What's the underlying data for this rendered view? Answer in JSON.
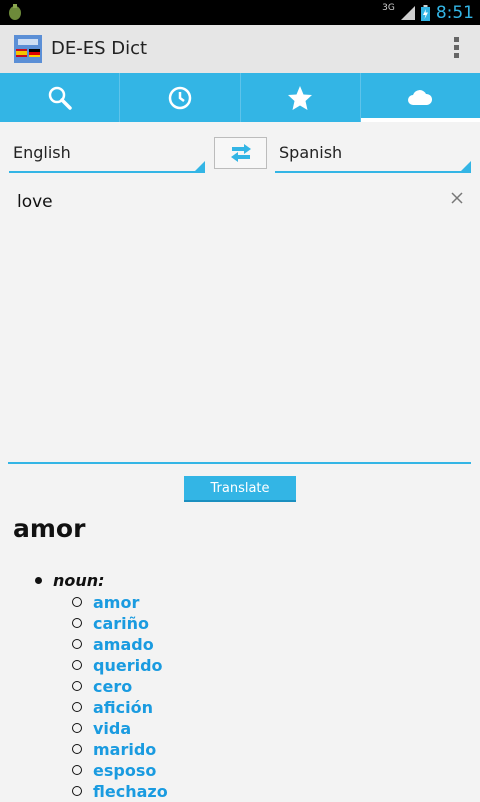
{
  "status_bar": {
    "network": "3G",
    "time": "8:51"
  },
  "app": {
    "title": "DE-ES Dict"
  },
  "tabs": [
    {
      "icon": "search-icon",
      "active": false
    },
    {
      "icon": "history-clock-icon",
      "active": false
    },
    {
      "icon": "star-icon",
      "active": false
    },
    {
      "icon": "cloud-icon",
      "active": true
    }
  ],
  "languages": {
    "source": "English",
    "target": "Spanish"
  },
  "input": {
    "value": "love"
  },
  "translate_button": {
    "label": "Translate"
  },
  "result": {
    "word": "amor",
    "part_of_speech": "noun:",
    "translations": [
      "amor",
      "cariño",
      "amado",
      "querido",
      "cero",
      "afición",
      "vida",
      "marido",
      "esposo",
      "flechazo"
    ]
  },
  "colors": {
    "accent": "#33b5e5",
    "link": "#1a9be0"
  }
}
